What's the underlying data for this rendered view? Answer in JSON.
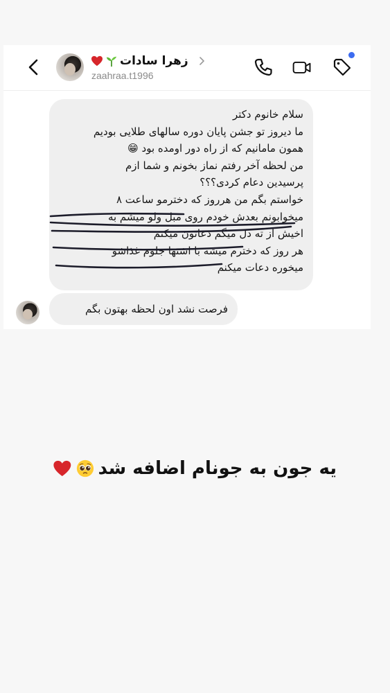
{
  "chat_header": {
    "contact_name": "زهرا سادات",
    "username": "zaahraa.t1996",
    "name_emojis": [
      "sprout-emoji",
      "red-heart-emoji"
    ],
    "icons": [
      "back-arrow-icon",
      "phone-icon",
      "video-call-icon",
      "tag-icon"
    ],
    "notification_dot_color": "#3d6cf0"
  },
  "messages": [
    {
      "sender": "zaahraa.t1996",
      "lines": [
        "سلام خانوم دکتر",
        "ما دیروز تو جشن پایان دوره سالهای طلایی بودیم",
        "همون مامانیم که از راه دور اومده بود 😁",
        "من لحظه آخر رفتم نماز بخونم و شما ازم",
        "پرسیدین دعام کردی؟؟؟",
        "خواستم بگم من هرروز که دخترمو ساعت ۸",
        "میخوابونم بعدش خودم روی مبل ولو میشم به",
        "اخیش از ته دل میگم دعاتون میکنم",
        "هر روز که دخترم میشه با اشتها جلوم غذاشو",
        "میخوره دعات میکنم"
      ]
    },
    {
      "sender": "zaahraa.t1996",
      "text": "فرصت نشد اون لحظه بهتون بگم"
    }
  ],
  "caption": {
    "text": "یه جون به جونام اضافه شد",
    "emojis": [
      "pleading-face-emoji",
      "red-heart-emoji"
    ]
  },
  "colors": {
    "page_background": "#f7f7f7",
    "bubble_background": "#efefef",
    "heart": "#d7262b",
    "underline_ink": "#1c1c2a"
  }
}
